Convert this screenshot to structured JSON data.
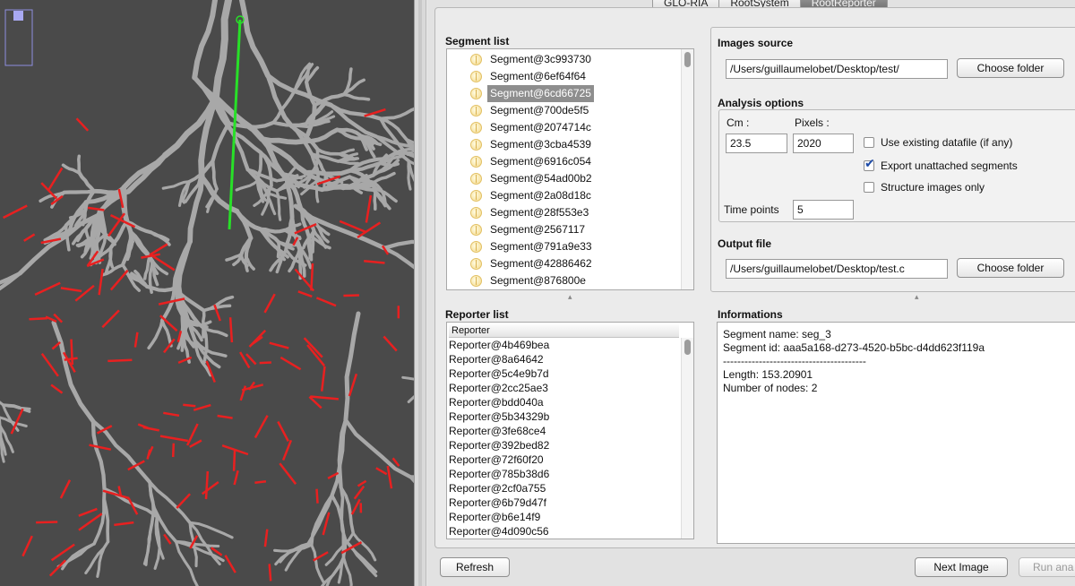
{
  "tabs": [
    {
      "label": "GLO-RIA",
      "active": false
    },
    {
      "label": "RootSystem",
      "active": false
    },
    {
      "label": "RootReporter",
      "active": true
    }
  ],
  "segment_list": {
    "title": "Segment list",
    "items": [
      "Segment@3c993730",
      "Segment@6ef64f64",
      "Segment@6cd66725",
      "Segment@700de5f5",
      "Segment@2074714c",
      "Segment@3cba4539",
      "Segment@6916c054",
      "Segment@54ad00b2",
      "Segment@2a08d18c",
      "Segment@28f553e3",
      "Segment@2567117",
      "Segment@791a9e33",
      "Segment@42886462",
      "Segment@876800e"
    ],
    "selected_index": 2
  },
  "reporter_list": {
    "title": "Reporter list",
    "column_header": "Reporter",
    "items": [
      "Reporter@4b469bea",
      "Reporter@8a64642",
      "Reporter@5c4e9b7d",
      "Reporter@2cc25ae3",
      "Reporter@bdd040a",
      "Reporter@5b34329b",
      "Reporter@3fe68ce4",
      "Reporter@392bed82",
      "Reporter@72f60f20",
      "Reporter@785b38d6",
      "Reporter@2cf0a755",
      "Reporter@6b79d47f",
      "Reporter@b6e14f9",
      "Reporter@4d090c56"
    ]
  },
  "images_source": {
    "title": "Images source",
    "path": "/Users/guillaumelobet/Desktop/test/",
    "button": "Choose folder"
  },
  "analysis_options": {
    "title": "Analysis options",
    "cm_label": "Cm :",
    "cm_value": "23.5",
    "pixels_label": "Pixels :",
    "pixels_value": "2020",
    "use_existing": {
      "label": "Use existing datafile (if any)",
      "checked": false
    },
    "export_unattached": {
      "label": "Export unattached segments",
      "checked": true
    },
    "structure_only": {
      "label": "Structure images only",
      "checked": false
    },
    "time_points_label": "Time points",
    "time_points_value": "5"
  },
  "output_file": {
    "title": "Output file",
    "path": "/Users/guillaumelobet/Desktop/test.c",
    "button": "Choose folder"
  },
  "informations": {
    "title": "Informations",
    "lines": [
      "Segment name: seg_3",
      "Segment id: aaa5a168-d273-4520-b5bc-d4dd623f119a",
      "----------------------------------------",
      "Length: 153.20901",
      "Number of nodes: 2"
    ]
  },
  "buttons": {
    "refresh": "Refresh",
    "next_image": "Next Image",
    "run_analysis": "Run ana"
  },
  "colors": {
    "image_background": "#4a4a4a",
    "root_gray": "#a8a8a8",
    "segment_red": "#e82020",
    "selected_green": "#28e028",
    "selection_gray": "#8e8e8e"
  }
}
